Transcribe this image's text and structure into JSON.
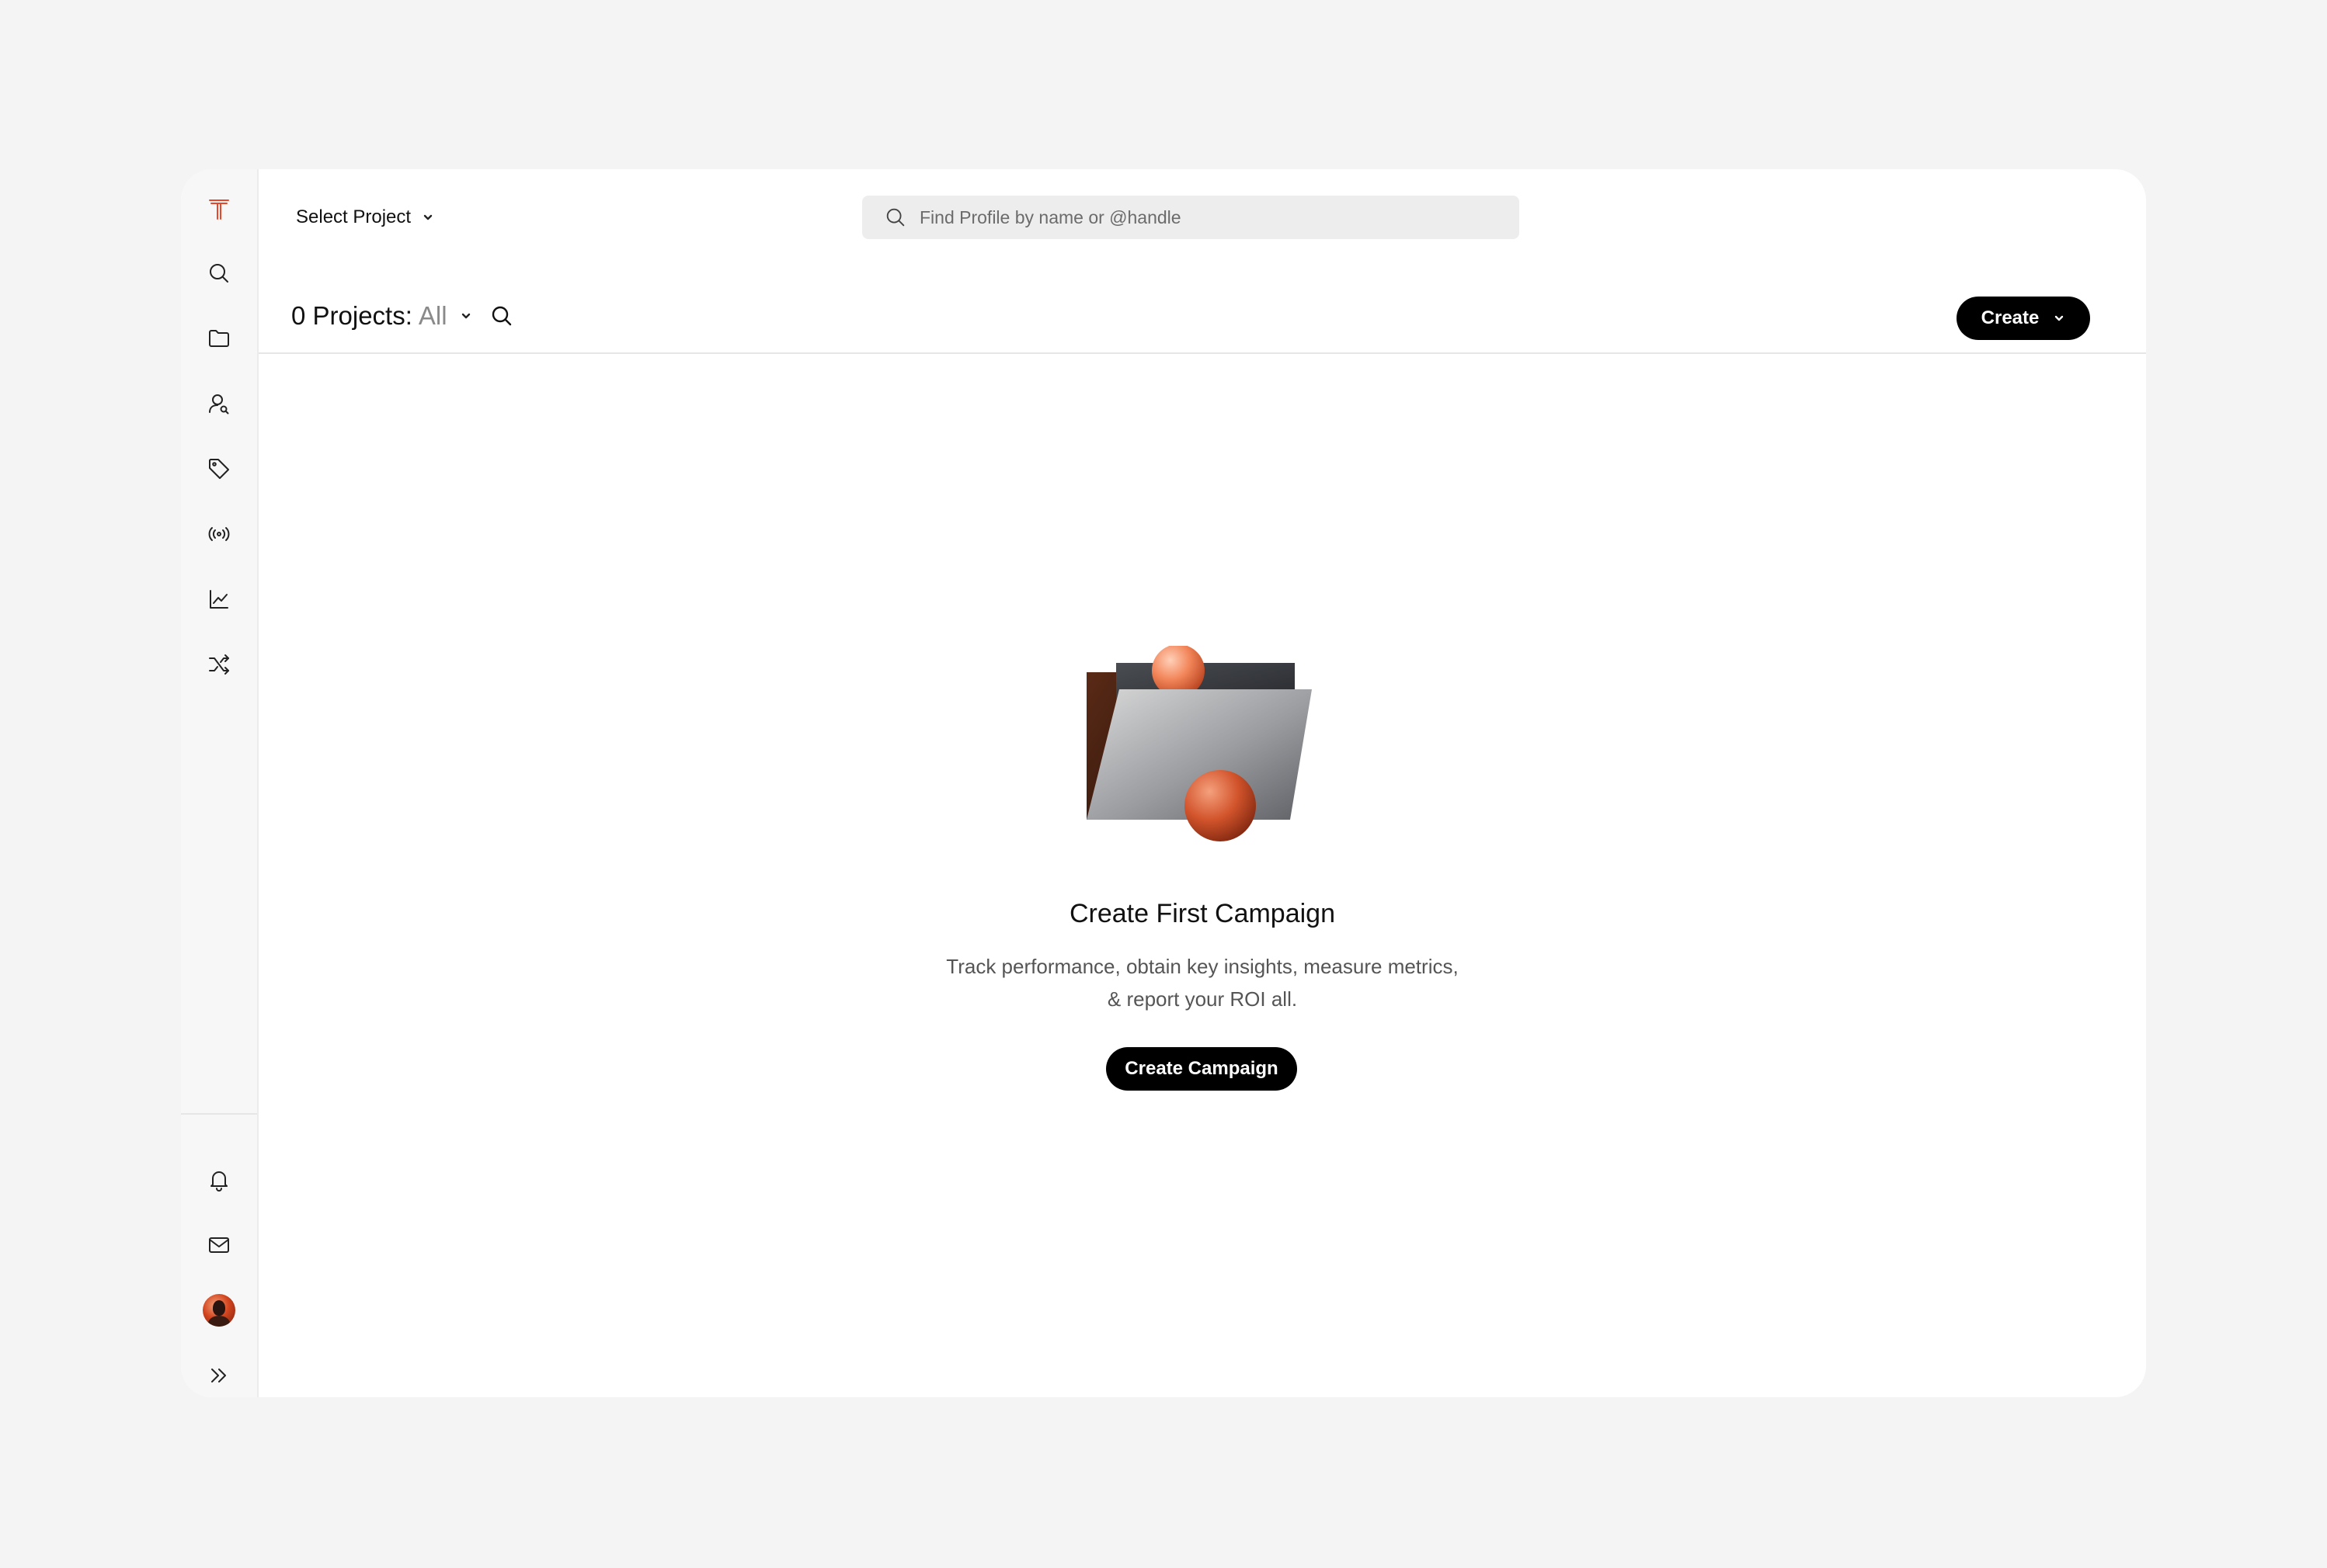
{
  "topbar": {
    "project_selector_label": "Select Project",
    "search_placeholder": "Find Profile by name or @handle"
  },
  "header": {
    "projects_count_label": "0 Projects:",
    "filter_value": "All",
    "create_button_label": "Create"
  },
  "sidebar": {
    "top_items": [
      "logo-icon",
      "search-icon",
      "folder-icon",
      "user-search-icon",
      "tag-icon",
      "broadcast-icon",
      "chart-line-icon",
      "shuffle-icon"
    ],
    "bottom_items": [
      "bell-icon",
      "mail-icon",
      "avatar",
      "expand-icon"
    ]
  },
  "empty_state": {
    "title": "Create First Campaign",
    "description_line1": "Track performance, obtain key insights, measure metrics,",
    "description_line2": "& report your ROI all.",
    "cta_label": "Create Campaign"
  },
  "colors": {
    "brand_accent": "#e8472a",
    "primary_button": "#000000",
    "page_background": "#f4f4f4"
  }
}
